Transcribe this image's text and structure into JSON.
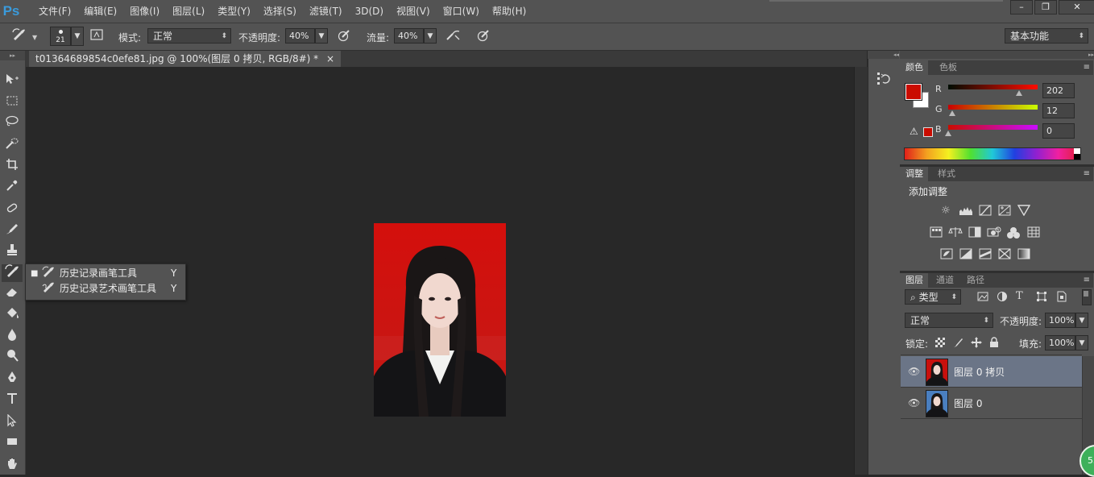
{
  "app": {
    "logo": "Ps"
  },
  "menu": [
    "文件(F)",
    "编辑(E)",
    "图像(I)",
    "图层(L)",
    "类型(Y)",
    "选择(S)",
    "滤镜(T)",
    "3D(D)",
    "视图(V)",
    "窗口(W)",
    "帮助(H)"
  ],
  "window_controls": {
    "minimize": "–",
    "restore": "❐",
    "close": "✕"
  },
  "options": {
    "brush_size": "21",
    "mode_label": "模式:",
    "mode_value": "正常",
    "opacity_label": "不透明度:",
    "opacity_value": "40%",
    "flow_label": "流量:",
    "flow_value": "40%",
    "workspace": "基本功能"
  },
  "document": {
    "tab_title": "t01364689854c0efe81.jpg @ 100%(图层 0 拷贝, RGB/8#) *",
    "tab_close": "×"
  },
  "flyout": {
    "items": [
      {
        "label": "历史记录画笔工具",
        "key": "Y",
        "selected": true
      },
      {
        "label": "历史记录艺术画笔工具",
        "key": "Y",
        "selected": false
      }
    ]
  },
  "color_panel": {
    "tabs": [
      "颜色",
      "色板"
    ],
    "fg_color": "#ca0c00",
    "bg_color": "#ffffff",
    "channels": [
      {
        "label": "R",
        "value": "202",
        "fraction": 0.792
      },
      {
        "label": "G",
        "value": "12",
        "fraction": 0.047
      },
      {
        "label": "B",
        "value": "0",
        "fraction": 0.0
      }
    ]
  },
  "adjust_panel": {
    "tabs": [
      "调整",
      "样式"
    ],
    "title": "添加调整",
    "rows": [
      [
        "brightness-icon",
        "levels-icon",
        "curves-icon",
        "exposure-icon",
        "vibrance-icon"
      ],
      [
        "hue-saturation-icon",
        "color-balance-icon",
        "black-white-icon",
        "photo-filter-icon",
        "channel-mixer-icon",
        "color-lookup-icon"
      ],
      [
        "invert-icon",
        "posterize-icon",
        "threshold-icon",
        "selective-color-icon",
        "gradient-map-icon"
      ]
    ]
  },
  "layers_panel": {
    "tabs": [
      "图层",
      "通道",
      "路径"
    ],
    "filter_label": "类型",
    "blend_mode": "正常",
    "opacity_label": "不透明度:",
    "opacity_value": "100%",
    "lock_label": "锁定:",
    "fill_label": "填充:",
    "fill_value": "100%",
    "layers": [
      {
        "name": "图层 0 拷贝",
        "selected": true,
        "bg": "#c8100d"
      },
      {
        "name": "图层 0",
        "selected": false,
        "bg": "#4a7fc0"
      }
    ]
  },
  "badge": "53"
}
